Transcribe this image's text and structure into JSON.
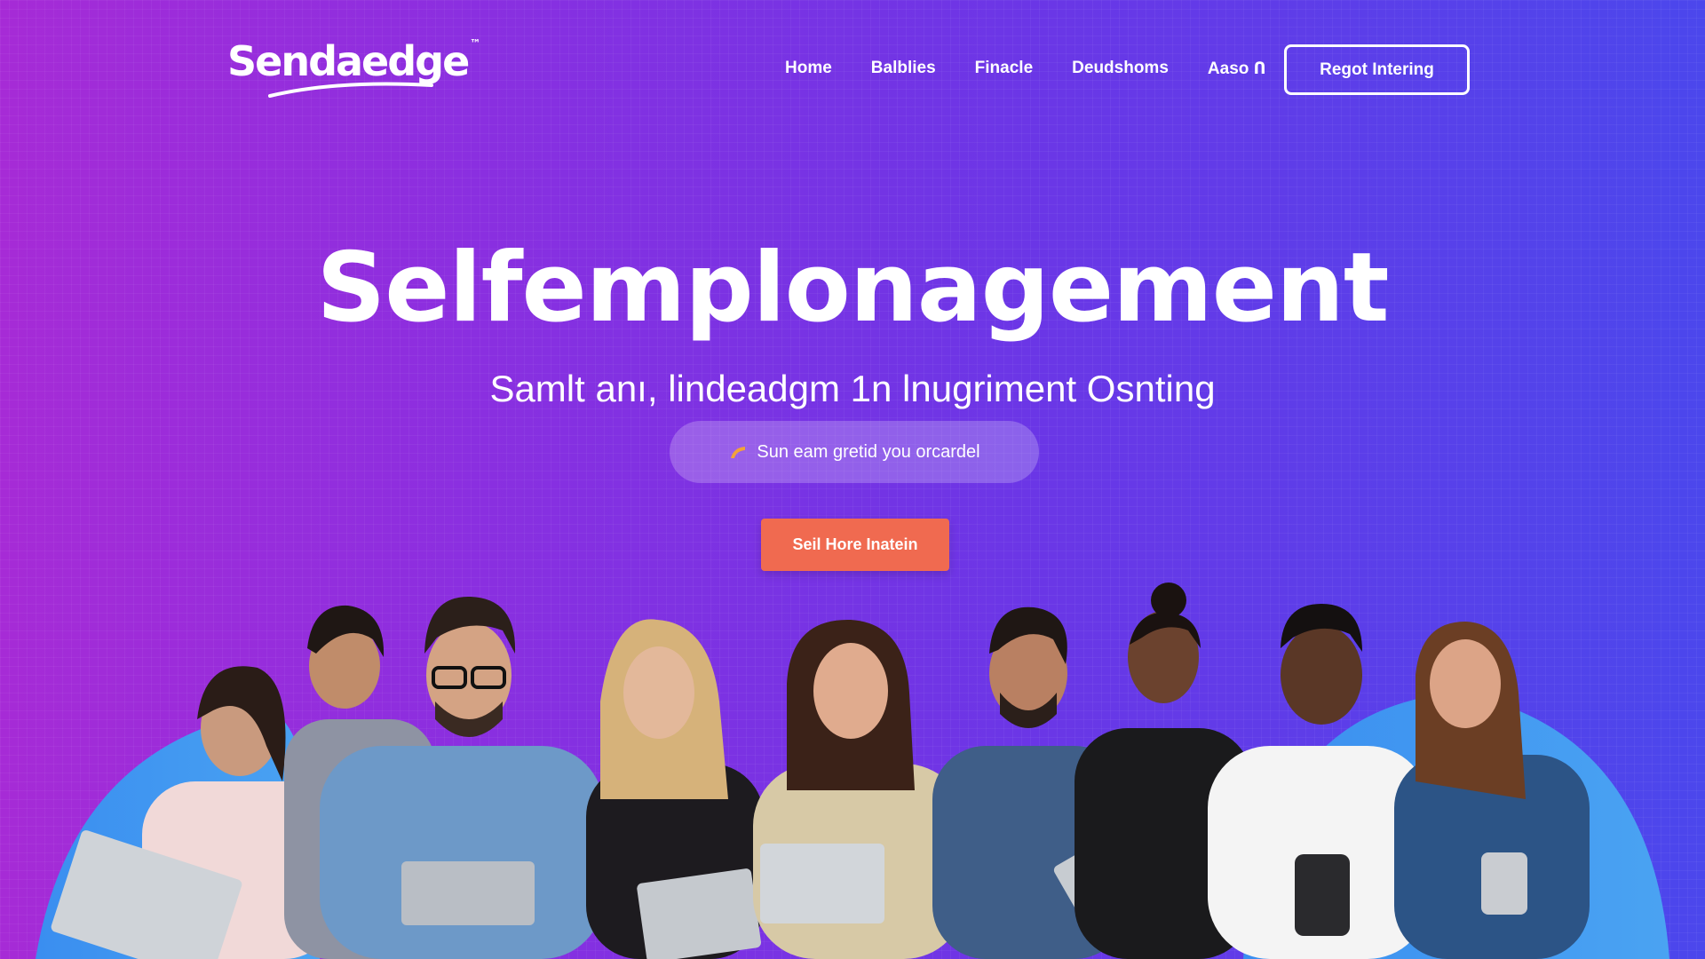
{
  "header": {
    "logo_text": "Sendaedge",
    "logo_mark": "™",
    "nav": [
      "Home",
      "Balblies",
      "Finacle",
      "Deudshoms",
      "Aaso Ո"
    ],
    "cta_label": "Regot Intering"
  },
  "hero": {
    "title": "Selfemplonagement",
    "subtitle": "Samlt anı, lindeadgm 1n lnugriment Osnting",
    "pill_text": "Sun eam gretid you orcardel",
    "pill_icon": "orange-swoosh-icon",
    "cta_label": "Seil Hore Inatein"
  },
  "people": {
    "description_icon": "group-photo-illustration",
    "count": 9
  },
  "colors": {
    "bg_left": "#a62bd6",
    "bg_right": "#4b47ec",
    "cta": "#f06a50",
    "blob": "#3d8ff0"
  }
}
